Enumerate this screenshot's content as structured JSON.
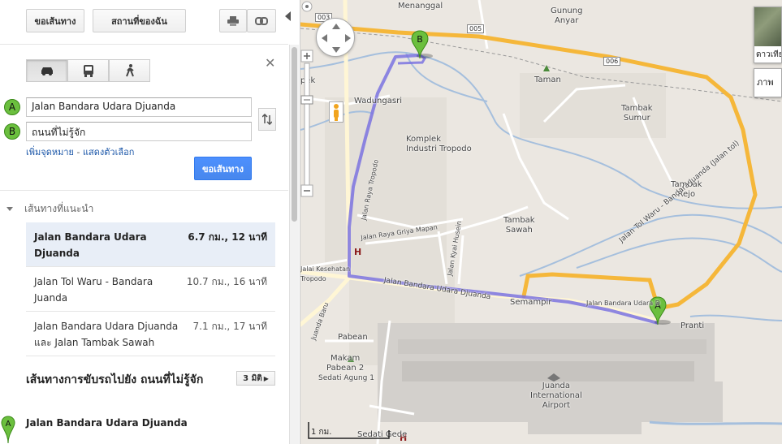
{
  "toolbar": {
    "get_directions_label": "ขอเส้นทาง",
    "my_places_label": "สถานที่ของฉัน"
  },
  "directions": {
    "waypoint_a_letter": "A",
    "waypoint_b_letter": "B",
    "origin_value": "Jalan Bandara Udara Djuanda",
    "destination_value": "ถนนที่ไม่รู้จัก",
    "add_destination_label": "เพิ่มจุดหมาย",
    "link_separator": " - ",
    "show_options_label": "แสดงตัวเลือก",
    "submit_label": "ขอเส้นทาง"
  },
  "suggested": {
    "heading": "เส้นทางที่แนะนำ",
    "routes": [
      {
        "name": "Jalan Bandara Udara Djuanda",
        "meta": "6.7 กม., 12 นาที"
      },
      {
        "name": "Jalan Tol Waru - Bandara Juanda",
        "meta": "10.7 กม., 16 นาที"
      },
      {
        "name": "Jalan Bandara Udara Djuanda และ Jalan Tambak Sawah",
        "meta": "7.1 กม., 17 นาที"
      }
    ]
  },
  "driving": {
    "title": "เส้นทางการขับรถไปยัง ถนนที่ไม่รู้จัก",
    "steps_label": "3 มิติ",
    "start_letter": "A",
    "start_name": "Jalan Bandara Udara Djuanda"
  },
  "map": {
    "marker_a": "A",
    "marker_b": "B",
    "labels": {
      "menanggal": "Menanggal",
      "gunung_anyar": "Gunung\nAnyar",
      "taman": "Taman",
      "tambak_sumur": "Tambak\nSumur",
      "wadungasri": "Wadungasri",
      "komplek": "Komplek\nIndustri Tropodo",
      "tambak_rejo": "Tambak\nRejo",
      "tambak_sawah": "Tambak\nSawah",
      "jl_raya_griya": "Jalan Raya Griya Mapan",
      "jl_raya_tropodo": "Jalan Raya Tropodo",
      "jl_kyai_husein": "Jalan Kyai Husein",
      "jl_bandara": "Jalan Bandara Udara Djuanda",
      "jl_bandara_2": "Jalan Bandara Udara D",
      "jl_tol": "Jalan Tol Waru - Bandara Juanda (Jalan tol)",
      "semampir": "Semampir",
      "pranti": "Pranti",
      "pabean": "Pabean",
      "makam": "Makam\nPabean 2",
      "sedati_agung": "Sedati Agung 1",
      "juanda_airport": "Juanda\nInternational\nAirport",
      "sedati_gede": "Sedati Gede",
      "kesehatan": "Jalai Kesehatan\nTropodo",
      "pek": "pek",
      "juanda_baru": "Juanda Baru",
      "h_marker": "H"
    },
    "shields": [
      "003",
      "005",
      "006"
    ],
    "map_type_label": "ดาวเทียม",
    "terrain_label": "ภาพ",
    "scale_label": "1 กม."
  },
  "colors": {
    "route": "#7b73e0",
    "highway": "#f5b73a",
    "water": "#a5bfdd",
    "accent_button": "#4787ed",
    "marker_green": "#6bbf3e"
  }
}
